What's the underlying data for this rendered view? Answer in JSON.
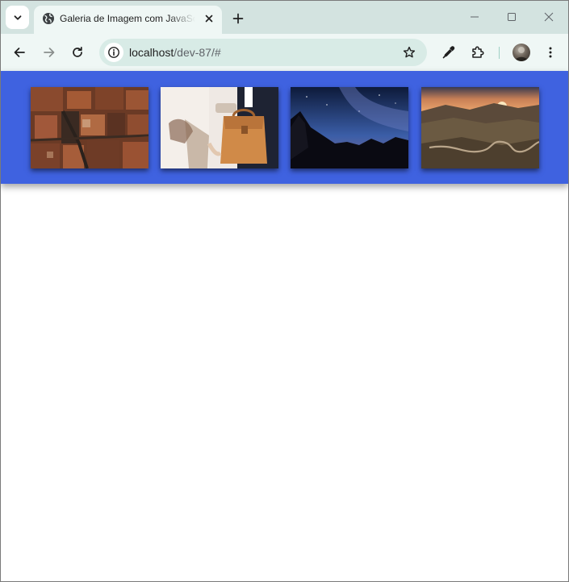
{
  "browser": {
    "tab": {
      "title": "Galeria de Imagem com JavaScript",
      "favicon": "globe-icon",
      "close": "close-icon"
    },
    "new_tab_icon": "plus-icon",
    "window_controls": [
      "minimize-icon",
      "maximize-icon",
      "close-icon"
    ],
    "toolbar": {
      "back": "arrow-left-icon",
      "forward": "arrow-right-icon",
      "reload": "reload-icon",
      "site_info": "info-icon",
      "bookmark": "star-icon",
      "eyedropper": "eyedropper-icon",
      "extensions": "puzzle-icon",
      "menu": "kebab-menu-icon"
    },
    "url": {
      "host": "localhost",
      "path": "/dev-87/#"
    }
  },
  "gallery": {
    "background_color": "#3f62e0",
    "images": [
      {
        "subject": "aerial view of red rooftops"
      },
      {
        "subject": "person holding a brown leather bag"
      },
      {
        "subject": "starry night sky over rocky mountains"
      },
      {
        "subject": "winding road through hills at sunset"
      }
    ]
  }
}
